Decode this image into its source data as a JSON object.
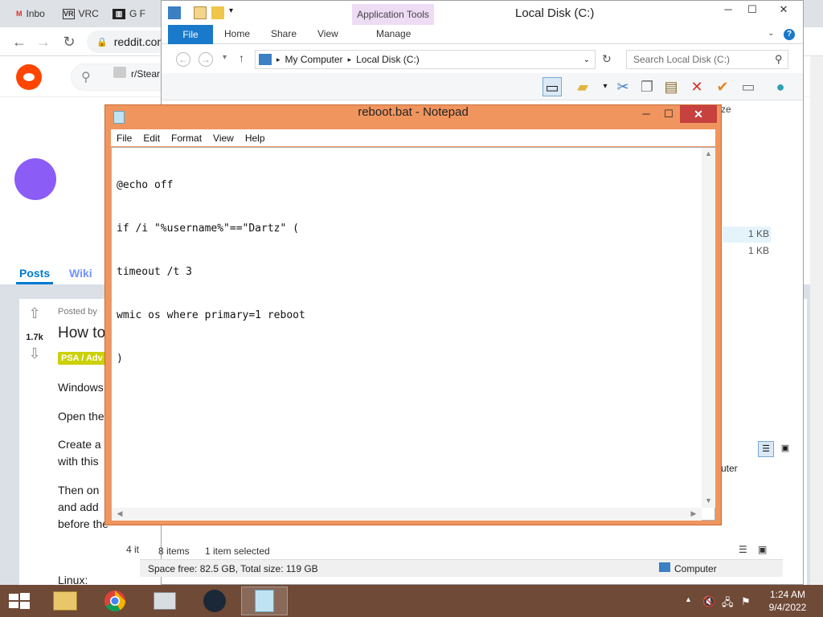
{
  "browser": {
    "tabs": [
      {
        "label": "Inbo",
        "icon": "gmail-icon"
      },
      {
        "label": "VRC",
        "icon": "vr-icon"
      },
      {
        "label": "G F",
        "icon": "museum-icon"
      }
    ],
    "address": "reddit.com"
  },
  "reddit": {
    "search_text": "r/Stear",
    "subreddit_name": "r/Stea",
    "tabs": [
      "Posts",
      "Wiki"
    ],
    "posted_by": "Posted by",
    "vote_count": "1.7k",
    "post_title": "How to",
    "flair": "PSA / Adv",
    "paragraphs": [
      "Windows",
      "Open the",
      "Create a",
      "with this",
      "Then on",
      "and add",
      "before the"
    ],
    "linux_label": "Linux:"
  },
  "explorer": {
    "title": "Local Disk (C:)",
    "app_tools": "Application Tools",
    "ribbon_tabs": {
      "file": "File",
      "home": "Home",
      "share": "Share",
      "view": "View",
      "manage": "Manage"
    },
    "path": [
      "My Computer",
      "Local Disk (C:)"
    ],
    "search_placeholder": "Search Local Disk (C:)",
    "column_partial": "ze",
    "sizes": [
      "1 KB",
      "1 KB"
    ],
    "nav_partial": "uter",
    "status_items": "8 items",
    "status_selected": "1 item selected",
    "status_partial": "4 it"
  },
  "details": {
    "space": "Space free: 82.5 GB, Total size: 119 GB",
    "location": "Computer"
  },
  "notepad": {
    "title": "reboot.bat - Notepad",
    "menu": [
      "File",
      "Edit",
      "Format",
      "View",
      "Help"
    ],
    "lines": [
      "@echo off",
      "if /i \"%username%\"==\"Dartz\" (",
      "timeout /t 3",
      "wmic os where primary=1 reboot",
      ")"
    ]
  },
  "taskbar": {
    "time": "1:24 AM",
    "date": "9/4/2022"
  },
  "colors": {
    "taskbar": "#6f4a36",
    "notepad_frame": "#f0955e",
    "reddit_orange": "#ff4500",
    "subreddit_avatar": "#8b5cf6",
    "file_tab": "#1979ca"
  }
}
